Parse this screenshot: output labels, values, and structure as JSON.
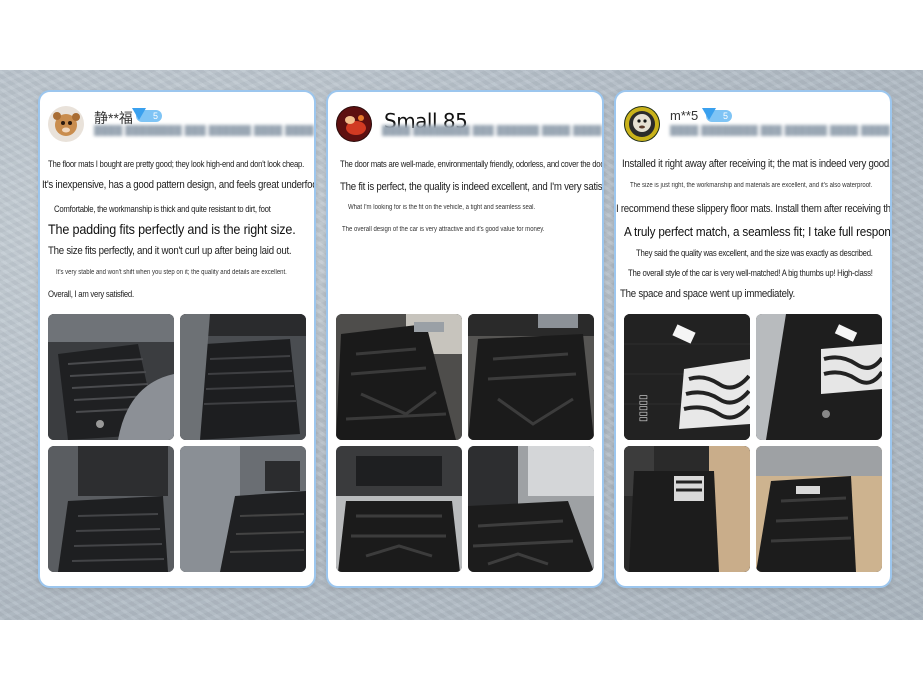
{
  "reviews": [
    {
      "username": "静**福",
      "badge_level": "5",
      "lines": [
        "The floor mats I bought are pretty good; they look high-end and don't look cheap.",
        "It's inexpensive, has a good pattern design, and feels great underfoot.",
        "Comfortable, the workmanship is thick and quite resistant to dirt, foot",
        "The padding fits perfectly and is the right size.",
        "The size fits perfectly, and it won't curl up after being laid out.",
        "It's very stable and won't shift when you step on it; the quality and details are excellent.",
        "Overall, I am very satisfied."
      ]
    },
    {
      "username": "Small 85",
      "lines": [
        "The door mats are well-made, environmentally friendly, odorless, and cover the door sill.",
        "The fit is perfect, the quality is indeed excellent, and I'm very satisfied.",
        "What I'm looking for is the fit on the vehicle, a tight and seamless seal.",
        "The overall design of the car is very attractive and it's good value for money."
      ]
    },
    {
      "username": "m**5",
      "badge_level": "5",
      "lines": [
        "Installed it right away after receiving it; the mat is indeed very good.",
        "The size is just right, the workmanship and materials are excellent, and it's also waterproof.",
        "I recommend these slippery floor mats. Install them after receiving them.",
        "A truly perfect match, a seamless fit; I take full responsibility.",
        "They said the quality was excellent, and the size was exactly as described.",
        "The overall style of the car is very well-matched! A big thumbs up! High-class!",
        "The space and space went up immediately."
      ]
    }
  ],
  "colors": {
    "card_border": "#9cc6ee",
    "badge": "#7fc4f5",
    "background_band": "#b7c1ca"
  }
}
